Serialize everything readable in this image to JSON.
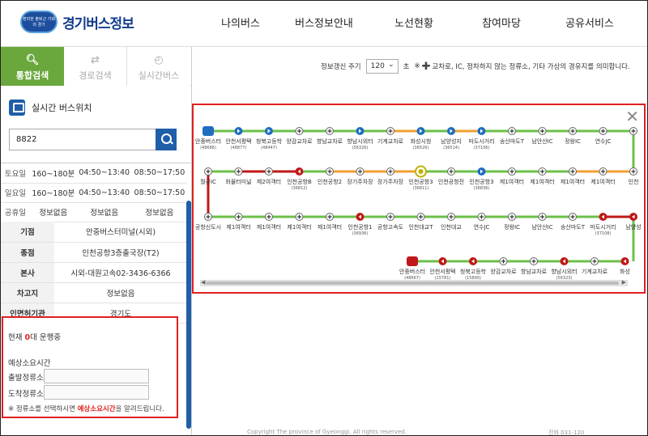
{
  "header": {
    "logo_badge": "편리한 출퇴근 기회의 경기",
    "logo_text": "경기버스정보",
    "nav": [
      "나의버스",
      "버스정보안내",
      "노선현황",
      "참여마당",
      "공유서비스"
    ]
  },
  "tabs": [
    {
      "label": "통합검색",
      "icon": "search-icon",
      "active": true
    },
    {
      "label": "경로검색",
      "icon": "shuffle-icon",
      "active": false
    },
    {
      "label": "실시간버스",
      "icon": "clock-icon",
      "active": false
    }
  ],
  "realtime_title": "실시간 버스위치",
  "search_value": "8822",
  "schedule": [
    {
      "day": "토요일",
      "interval": "160~180분",
      "first": "04:50~13:40",
      "last": "08:50~17:50"
    },
    {
      "day": "일요일",
      "interval": "160~180분",
      "first": "04:50~13:40",
      "last": "08:50~17:50"
    },
    {
      "day": "공휴일",
      "interval": "정보없음",
      "first": "정보없음",
      "last": "정보없음"
    }
  ],
  "info": [
    {
      "key": "기점",
      "value": "안중버스터미널(시외)"
    },
    {
      "key": "종점",
      "value": "인천공항3층출국장(T2)"
    },
    {
      "key": "본사",
      "value": "시외-대원고속02-3436-6366"
    },
    {
      "key": "차고지",
      "value": "정보없음"
    },
    {
      "key": "인면허기관",
      "value": "경기도"
    }
  ],
  "operation": {
    "prefix": "현재",
    "count": "0",
    "suffix": "대 운행중",
    "eta_title": "예상소요시간",
    "from_label": "출발정류소",
    "to_label": "도착정류소",
    "note_a": "※ 정류소를 선택하시면 ",
    "note_hl": "예상소요시간",
    "note_b": "을 알려드립니다."
  },
  "update": {
    "label": "정보갱신 주기",
    "value": "120",
    "unit": "초",
    "note_prefix": "※",
    "note": "교차로, IC, 정차하지 않는 정류소, 기타 가상의 경유지를 의미합니다."
  },
  "route": {
    "colors": {
      "green": "#6cc04a",
      "orange": "#f0a030",
      "red": "#c01818",
      "blue": "#1f6ec0",
      "yellow": "#c0b000"
    },
    "row1": [
      {
        "label": "안중버스터",
        "sub": "(48686)",
        "type": "bus"
      },
      {
        "label": "안천서평택",
        "sub": "(48877)",
        "type": "blue"
      },
      {
        "label": "청북고등학",
        "sub": "(48447)",
        "type": "blue"
      },
      {
        "label": "양감교차로",
        "sub": "",
        "type": "plus"
      },
      {
        "label": "향남교차로",
        "sub": "",
        "type": "plus"
      },
      {
        "label": "향남시외터",
        "sub": "(56326)",
        "type": "blue"
      },
      {
        "label": "기계교차로",
        "sub": "",
        "type": "plus"
      },
      {
        "label": "화성시청",
        "sub": "(36526)",
        "type": "blue"
      },
      {
        "label": "남양성지",
        "sub": "(36514)",
        "type": "blue"
      },
      {
        "label": "마도시거리",
        "sub": "(37106)",
        "type": "blue"
      },
      {
        "label": "송산마도T",
        "sub": "",
        "type": "plus"
      },
      {
        "label": "남안산IC",
        "sub": "",
        "type": "plus"
      },
      {
        "label": "정왕IC",
        "sub": "",
        "type": "plus"
      },
      {
        "label": "연수JC",
        "sub": "",
        "type": "plus"
      },
      {
        "label": "",
        "sub": "",
        "type": "plus"
      }
    ],
    "row2": [
      {
        "label": "월곶IC",
        "sub": "",
        "type": "plus"
      },
      {
        "label": "화물터미널",
        "sub": "",
        "type": "plus"
      },
      {
        "label": "제2여객터",
        "sub": "",
        "type": "plus"
      },
      {
        "label": "인천공항B",
        "sub": "(36812)",
        "type": "red"
      },
      {
        "label": "인천공항2",
        "sub": "",
        "type": "plus"
      },
      {
        "label": "장기주차장",
        "sub": "",
        "type": "plus"
      },
      {
        "label": "장기주차장",
        "sub": "",
        "type": "plus"
      },
      {
        "label": "인천공항3",
        "sub": "(36811)",
        "type": "turn"
      },
      {
        "label": "인천공항전",
        "sub": "",
        "type": "plus"
      },
      {
        "label": "인천공항3",
        "sub": "(36836)",
        "type": "blue"
      },
      {
        "label": "제1여객터",
        "sub": "",
        "type": "plus"
      },
      {
        "label": "제1여객터",
        "sub": "",
        "type": "plus"
      },
      {
        "label": "제1여객터",
        "sub": "",
        "type": "plus"
      },
      {
        "label": "제1여객터",
        "sub": "",
        "type": "plus"
      },
      {
        "label": "인천",
        "sub": "",
        "type": "plus"
      }
    ],
    "row3": [
      {
        "label": "공항신도시",
        "sub": "",
        "type": "plus"
      },
      {
        "label": "제1여객터",
        "sub": "",
        "type": "plus"
      },
      {
        "label": "제1여객터",
        "sub": "",
        "type": "plus"
      },
      {
        "label": "제1여객터",
        "sub": "",
        "type": "plus"
      },
      {
        "label": "제1여객터",
        "sub": "",
        "type": "plus"
      },
      {
        "label": "인천공항1",
        "sub": "(36936)",
        "type": "red"
      },
      {
        "label": "공항고속도",
        "sub": "",
        "type": "plus"
      },
      {
        "label": "인천대교T",
        "sub": "",
        "type": "plus"
      },
      {
        "label": "인천대교",
        "sub": "",
        "type": "plus"
      },
      {
        "label": "연수JC",
        "sub": "",
        "type": "plus"
      },
      {
        "label": "정왕IC",
        "sub": "",
        "type": "plus"
      },
      {
        "label": "남안산IC",
        "sub": "",
        "type": "plus"
      },
      {
        "label": "송산마도T",
        "sub": "",
        "type": "plus"
      },
      {
        "label": "마도시거리",
        "sub": "(37108)",
        "type": "red"
      },
      {
        "label": "남양성",
        "sub": "",
        "type": "red"
      }
    ],
    "row4": [
      {
        "label": "안중버스터",
        "sub": "(48667)",
        "type": "busred"
      },
      {
        "label": "안천서평택",
        "sub": "(15781)",
        "type": "red"
      },
      {
        "label": "청북고등학",
        "sub": "(15899)",
        "type": "red"
      },
      {
        "label": "양감교차로",
        "sub": "",
        "type": "plus"
      },
      {
        "label": "향남교차로",
        "sub": "",
        "type": "plus"
      },
      {
        "label": "향남시외터",
        "sub": "(56323)",
        "type": "red"
      },
      {
        "label": "기계교차로",
        "sub": "",
        "type": "plus"
      },
      {
        "label": "화성",
        "sub": "",
        "type": "red"
      }
    ]
  },
  "footer": {
    "copyright": "Copyright The province of Gyeonggi. All rights reserved.",
    "tel": "전화 031-120"
  }
}
